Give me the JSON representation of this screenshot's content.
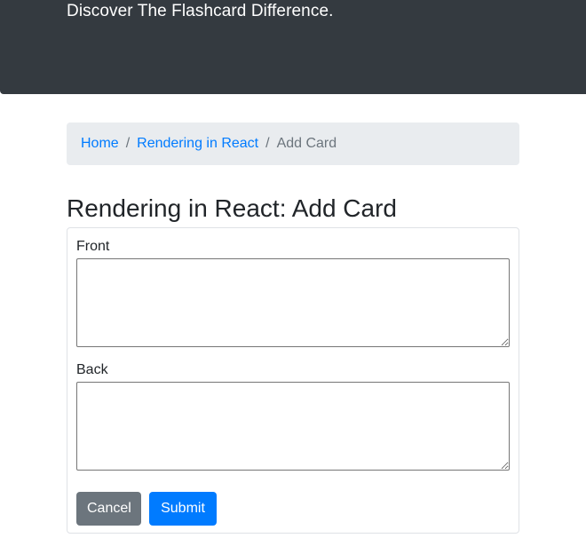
{
  "hero": {
    "tagline": "Discover The Flashcard Difference."
  },
  "breadcrumb": {
    "items": [
      {
        "label": "Home"
      },
      {
        "label": "Rendering in React"
      }
    ],
    "separator": "/",
    "active": "Add Card"
  },
  "page": {
    "title": "Rendering in React: Add Card"
  },
  "form": {
    "front_label": "Front",
    "front_value": "",
    "back_label": "Back",
    "back_value": "",
    "cancel_label": "Cancel",
    "submit_label": "Submit"
  },
  "colors": {
    "header_bg": "#343a40",
    "link": "#007bff",
    "breadcrumb_bg": "#e9ecef",
    "cancel_bg": "#6c757d",
    "submit_bg": "#007bff"
  }
}
